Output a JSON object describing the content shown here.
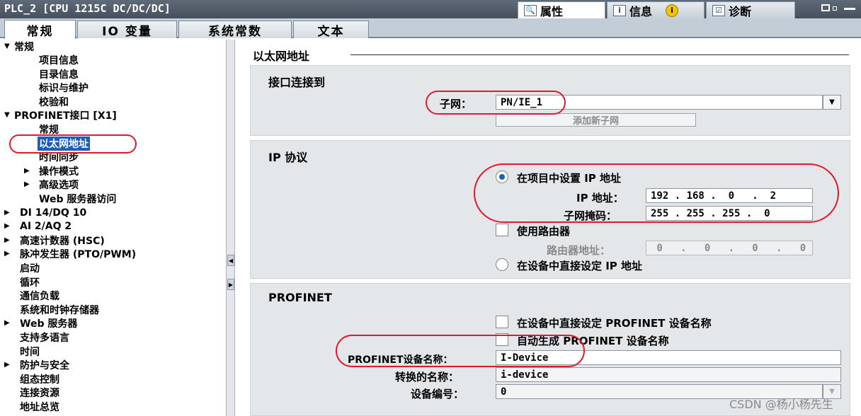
{
  "window": {
    "title": "PLC_2 [CPU 1215C DC/DC/DC]",
    "panel_tabs": [
      {
        "label": "属性",
        "icon": "properties-icon"
      },
      {
        "label": "信息",
        "icon": "info-icon",
        "badge": "i"
      },
      {
        "label": "诊断",
        "icon": "diagnostics-icon"
      }
    ]
  },
  "tabs": [
    "常规",
    "IO 变量",
    "系统常数",
    "文本"
  ],
  "nav": [
    {
      "label": "常规",
      "arrow": "▼"
    },
    {
      "label": "项目信息"
    },
    {
      "label": "目录信息"
    },
    {
      "label": "标识与维护"
    },
    {
      "label": "校验和"
    },
    {
      "label": "PROFINET接口 [X1]",
      "arrow": "▼"
    },
    {
      "label": "常规"
    },
    {
      "label": "以太网地址"
    },
    {
      "label": "时间同步"
    },
    {
      "label": "操作模式",
      "arrow": "▶"
    },
    {
      "label": "高级选项",
      "arrow": "▶"
    },
    {
      "label": "Web 服务器访问"
    },
    {
      "label": "DI 14/DQ 10",
      "arrow": "▶"
    },
    {
      "label": "AI 2/AQ 2",
      "arrow": "▶"
    },
    {
      "label": "高速计数器 (HSC)",
      "arrow": "▶"
    },
    {
      "label": "脉冲发生器 (PTO/PWM)",
      "arrow": "▶"
    },
    {
      "label": "启动"
    },
    {
      "label": "循环"
    },
    {
      "label": "通信负载"
    },
    {
      "label": "系统和时钟存储器"
    },
    {
      "label": "Web 服务器",
      "arrow": "▶"
    },
    {
      "label": "支持多语言"
    },
    {
      "label": "时间"
    },
    {
      "label": "防护与安全",
      "arrow": "▶"
    },
    {
      "label": "组态控制"
    },
    {
      "label": "连接资源"
    },
    {
      "label": "地址总览"
    }
  ],
  "content": {
    "section_title": "以太网地址",
    "interface": {
      "title": "接口连接到",
      "subnet_label": "子网：",
      "subnet_value": "PN/IE_1",
      "add_subnet_button": "添加新子网"
    },
    "ip": {
      "title": "IP 协议",
      "opt_set_in_project": "在项目中设置 IP 地址",
      "ip_label": "IP 地址：",
      "ip_value": "192 . 168 .  0   .  2",
      "mask_label": "子网掩码：",
      "mask_value": "255 . 255 . 255 .  0",
      "use_router": "使用路由器",
      "router_label": "路由器地址：",
      "router_value": " 0   .   0   .   0   .   0",
      "opt_set_on_device": "在设备中直接设定 IP 地址"
    },
    "profinet": {
      "title": "PROFINET",
      "opt_set_name_on_device": "在设备中直接设定 PROFINET 设备名称",
      "opt_auto_generate": "自动生成 PROFINET 设备名称",
      "name_label": "PROFINET设备名称：",
      "name_value": "I-Device",
      "converted_label": "转换的名称：",
      "converted_value": "i-device",
      "number_label": "设备编号：",
      "number_value": "0"
    }
  },
  "watermark": "CSDN @杨小杨先生",
  "colors": {
    "selection": "#1b5fb8",
    "annotation": "#e0192d",
    "panel": "#e4e7ea"
  }
}
